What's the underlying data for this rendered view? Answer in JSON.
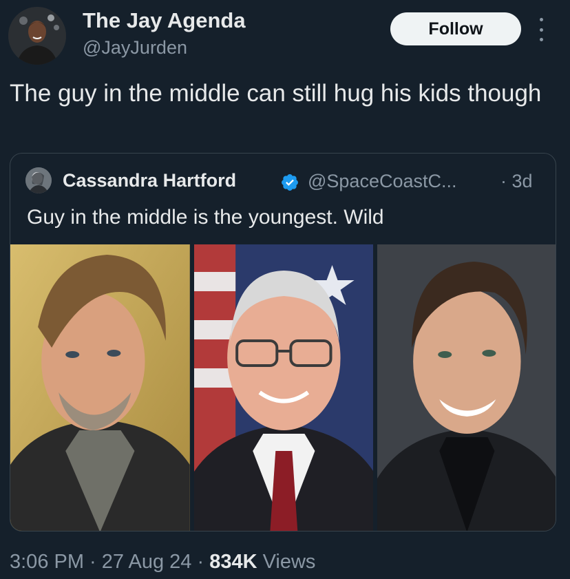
{
  "author": {
    "display_name": "The Jay Agenda",
    "handle": "@JayJurden"
  },
  "follow_label": "Follow",
  "tweet_text": "The guy in the middle can still hug his kids though",
  "quoted": {
    "display_name": "Cassandra Hartford",
    "handle": "@SpaceCoastC...",
    "time": "· 3d",
    "text": "Guy in the middle is the youngest. Wild"
  },
  "meta": {
    "time": "3:06 PM",
    "sep1": " · ",
    "date": "27 Aug 24",
    "sep2": " · ",
    "views_count": "834K",
    "views_label": " Views"
  },
  "colors": {
    "background": "#15202b",
    "accent_verified": "#1d9bf0",
    "follow_bg": "#eff3f4",
    "muted_text": "#8b98a5"
  },
  "icons": [
    "more-options-icon",
    "verified-badge-icon"
  ]
}
